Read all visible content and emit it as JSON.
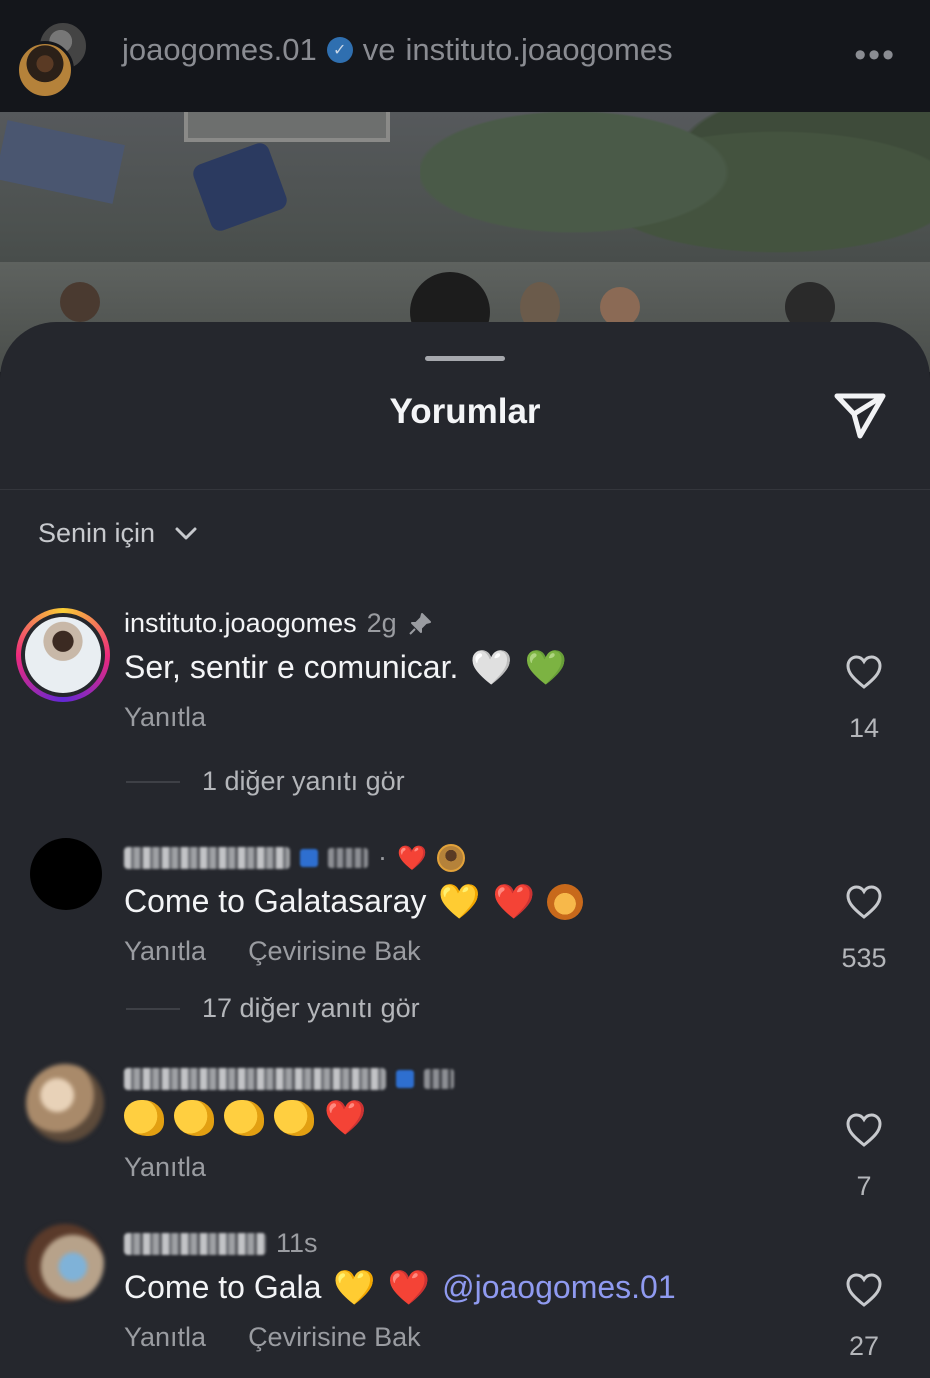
{
  "post_header": {
    "owner_primary": "joaogomes.01",
    "joiner": "ve",
    "owner_secondary": "instituto.joaogomes",
    "verified_icon": "verified-badge-icon",
    "more_icon": "more-horizontal-icon"
  },
  "sheet": {
    "title": "Yorumlar",
    "share_icon": "send-paper-plane-icon",
    "sort_label": "Senin için",
    "sort_icon": "chevron-down-icon"
  },
  "comments": [
    {
      "username": "instituto.joaogomes",
      "time": "2g",
      "pinned_icon": "pin-icon",
      "text": "Ser, sentir e comunicar.",
      "emojis": [
        "🤍",
        "💚"
      ],
      "reply_label": "Yanıtla",
      "likes": "14",
      "more_replies": "1 diğer yanıtı gör"
    },
    {
      "username": "",
      "time": "",
      "liked_by_creator": "❤️",
      "text": "Come to Galatasaray",
      "emojis": [
        "💛",
        "❤️",
        "🦁"
      ],
      "reply_label": "Yanıtla",
      "translate_label": "Çevirisine Bak",
      "likes": "535",
      "more_replies": "17 diğer yanıtı gör"
    },
    {
      "username": "",
      "time": "",
      "text": "",
      "emojis": [
        "👏",
        "👏",
        "👏",
        "👏",
        "❤️"
      ],
      "reply_label": "Yanıtla",
      "likes": "7"
    },
    {
      "username": "",
      "time": "11s",
      "text": "Come to Gala",
      "emojis": [
        "💛",
        "❤️"
      ],
      "mention": "@joaogomes.01",
      "reply_label": "Yanıtla",
      "translate_label": "Çevirisine Bak",
      "likes": "27"
    }
  ],
  "colors": {
    "sheet_bg": "#25272d",
    "mention": "#8f9af0",
    "story_ring": [
      "#f9ce34",
      "#ee2a7b",
      "#6228d7"
    ]
  }
}
